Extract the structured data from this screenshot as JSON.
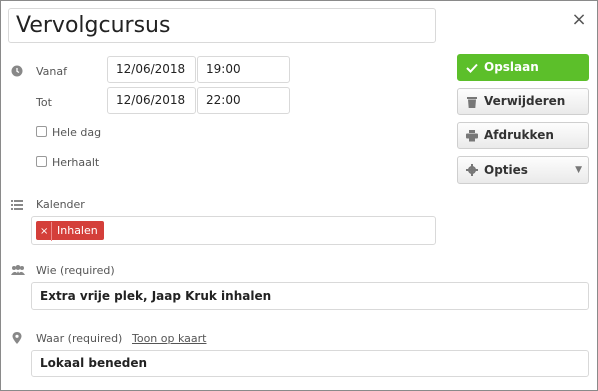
{
  "event": {
    "title": "Vervolgcursus"
  },
  "labels": {
    "from": "Vanaf",
    "to": "Tot",
    "all_day": "Hele dag",
    "repeats": "Herhaalt",
    "calendar": "Kalender",
    "who": "Wie (required)",
    "where": "Waar (required)",
    "show_on_map": "Toon op kaart"
  },
  "from": {
    "date": "12/06/2018",
    "time": "19:00"
  },
  "to": {
    "date": "12/06/2018",
    "time": "22:00"
  },
  "calendar_tag": {
    "remove": "×",
    "label": "Inhalen",
    "color": "#d43f3a"
  },
  "who_value": "Extra vrije plek, Jaap Kruk inhalen",
  "where_value": "Lokaal beneden",
  "buttons": {
    "save": "Opslaan",
    "delete": "Verwijderen",
    "print": "Afdrukken",
    "options": "Opties",
    "options_caret": "▼",
    "close": "×"
  },
  "colors": {
    "save": "#5cbf2a",
    "tag": "#d43f3a"
  }
}
